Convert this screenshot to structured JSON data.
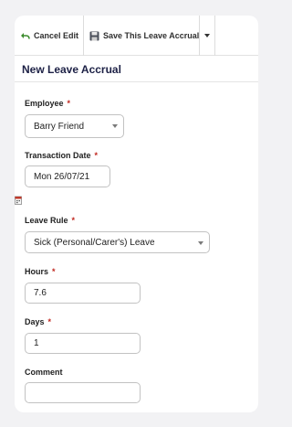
{
  "toolbar": {
    "cancel_label": "Cancel Edit",
    "save_label": "Save This Leave Accrual"
  },
  "section": {
    "title": "New Leave Accrual"
  },
  "form": {
    "employee": {
      "label": "Employee",
      "value": "Barry Friend"
    },
    "transaction_date": {
      "label": "Transaction Date",
      "value": "Mon 26/07/21"
    },
    "leave_rule": {
      "label": "Leave Rule",
      "value": "Sick (Personal/Carer's) Leave"
    },
    "hours": {
      "label": "Hours",
      "value": "7.6"
    },
    "days": {
      "label": "Days",
      "value": "1"
    },
    "comment": {
      "label": "Comment",
      "value": ""
    },
    "required_marker": "*"
  },
  "colors": {
    "title": "#1d2146",
    "required": "#c0271f",
    "border": "#c2c2c2"
  }
}
